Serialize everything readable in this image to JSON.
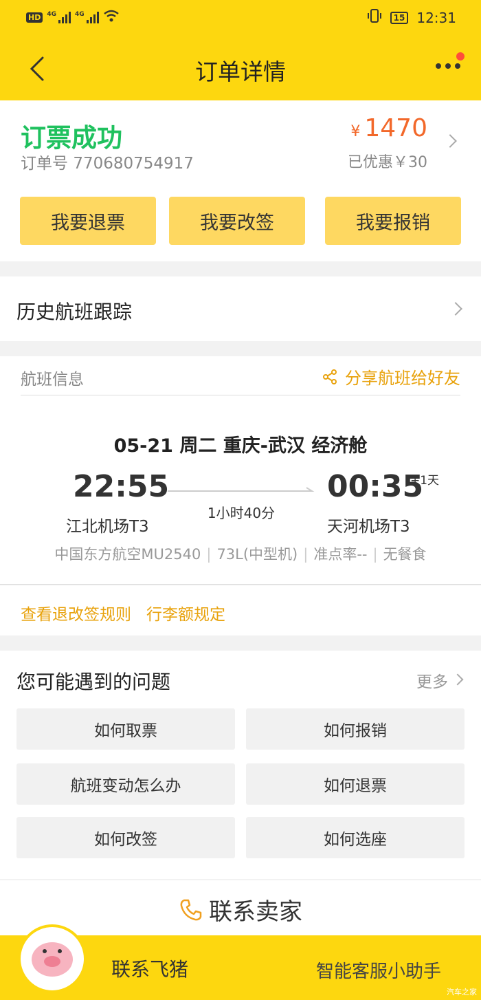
{
  "status_bar": {
    "hd": "HD",
    "sig1": "4G",
    "sig2": "4G",
    "battery": "15",
    "time": "12:31"
  },
  "nav": {
    "title": "订单详情"
  },
  "order": {
    "status": "订票成功",
    "order_label": "订单号",
    "order_no": "770680754917",
    "currency": "¥",
    "price": "1470",
    "discount": "已优惠￥30",
    "actions": [
      "我要退票",
      "我要改签",
      "我要报销"
    ]
  },
  "history": {
    "label": "历史航班跟踪"
  },
  "flight": {
    "section_title": "航班信息",
    "share": "分享航班给好友",
    "header": "05-21  周二  重庆-武汉  经济舱",
    "dep_time": "22:55",
    "arr_time": "00:35",
    "plus_day": "+1天",
    "duration": "1小时40分",
    "dep_airport": "江北机场T3",
    "arr_airport": "天河机场T3",
    "meta": [
      "中国东方航空MU2540",
      "73L(中型机)",
      "准点率--",
      "无餐食"
    ],
    "rules": [
      "查看退改签规则",
      "行李额规定"
    ]
  },
  "faq": {
    "title": "您可能遇到的问题",
    "more": "更多",
    "items": [
      "如何取票",
      "如何报销",
      "航班变动怎么办",
      "如何退票",
      "如何改签",
      "如何选座"
    ]
  },
  "contact_seller": "联系卖家",
  "bottom": {
    "contact": "联系飞猪",
    "assistant": "智能客服小助手",
    "watermark": "汽车之家"
  },
  "colors": {
    "brand_yellow": "#fdd70f",
    "button_yellow": "#fed861",
    "success_green": "#1fc15e",
    "price_orange": "#f2682a",
    "link_orange": "#e8a20c"
  }
}
